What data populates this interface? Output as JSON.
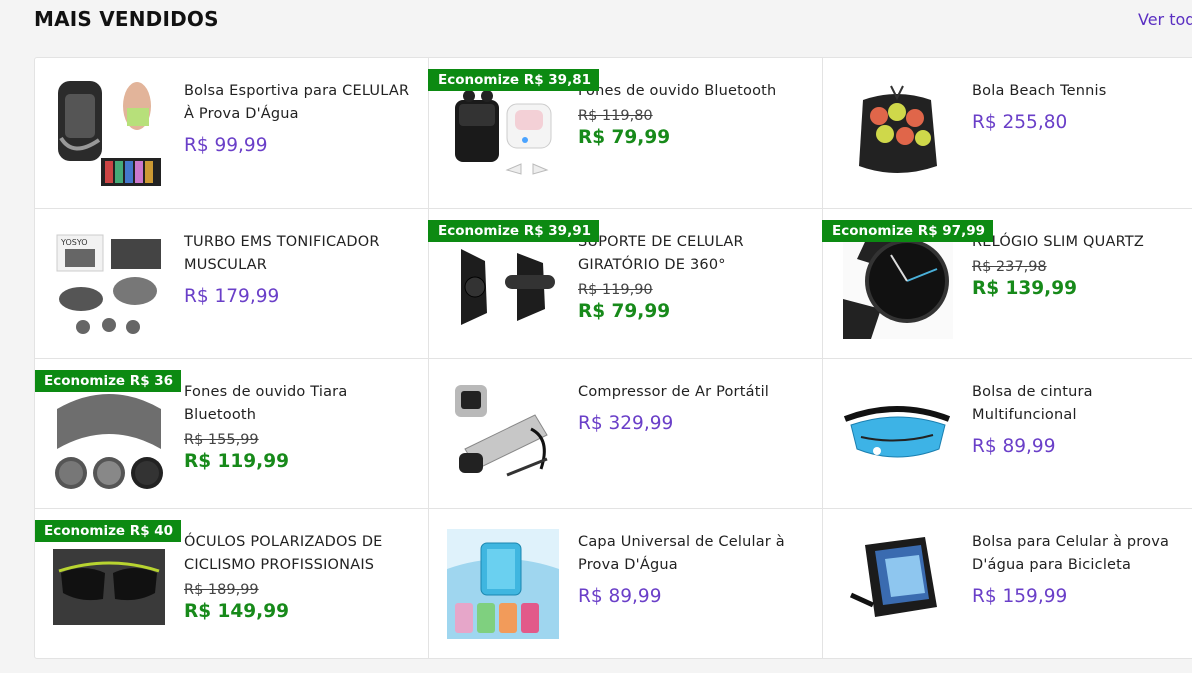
{
  "section": {
    "title": "MAIS VENDIDOS",
    "see_all": "Ver tod"
  },
  "products": [
    {
      "name": "Bolsa Esportiva para CELULAR À Prova D'Água",
      "price": "R$ 99,99",
      "badge": null,
      "old_price": null,
      "image_icon": "sport-armband-bag-image"
    },
    {
      "name": "Fones de ouvido Bluetooth",
      "price": "R$ 79,99",
      "badge": "Economize R$ 39,81",
      "old_price": "R$ 119,80",
      "image_icon": "wireless-earbuds-image"
    },
    {
      "name": "Bola Beach Tennis",
      "price": "R$ 255,80",
      "badge": null,
      "old_price": null,
      "image_icon": "beach-tennis-balls-image"
    },
    {
      "name": "TURBO EMS TONIFICADOR MUSCULAR",
      "price": "R$ 179,99",
      "badge": null,
      "old_price": null,
      "image_icon": "ems-muscle-toner-image"
    },
    {
      "name": "SUPORTE DE CELULAR GIRATÓRIO DE 360°",
      "price": "R$ 79,99",
      "badge": "Economize R$ 39,91",
      "old_price": "R$ 119,90",
      "image_icon": "bike-phone-holder-image"
    },
    {
      "name": "RELÓGIO SLIM QUARTZ",
      "price": "R$ 139,99",
      "badge": "Economize R$ 97,99",
      "old_price": "R$ 237,98",
      "image_icon": "quartz-watch-image"
    },
    {
      "name": "Fones de ouvido Tiara Bluetooth",
      "price": "R$ 119,99",
      "badge": "Economize R$ 36",
      "old_price": "R$ 155,99",
      "image_icon": "bluetooth-headband-image"
    },
    {
      "name": "Compressor de Ar Portátil",
      "price": "R$ 329,99",
      "badge": null,
      "old_price": null,
      "image_icon": "air-compressor-image"
    },
    {
      "name": "Bolsa de cintura Multifuncional",
      "price": "R$ 89,99",
      "badge": null,
      "old_price": null,
      "image_icon": "waist-bag-image"
    },
    {
      "name": "ÓCULOS POLARIZADOS DE CICLISMO PROFISSIONAIS",
      "price": "R$ 149,99",
      "badge": "Economize R$ 40",
      "old_price": "R$ 189,99",
      "image_icon": "cycling-sunglasses-image"
    },
    {
      "name": "Capa Universal de Celular à Prova D'Água",
      "price": "R$ 89,99",
      "badge": null,
      "old_price": null,
      "image_icon": "waterproof-phone-case-image"
    },
    {
      "name": "Bolsa para Celular à prova D'água para Bicicleta",
      "price": "R$ 159,99",
      "badge": null,
      "old_price": null,
      "image_icon": "bike-phone-bag-image"
    }
  ],
  "colors": {
    "accent": "#6a3fc8",
    "sale": "#178a1a",
    "badge_bg": "#0c8a12",
    "link": "#5a2fc2"
  }
}
